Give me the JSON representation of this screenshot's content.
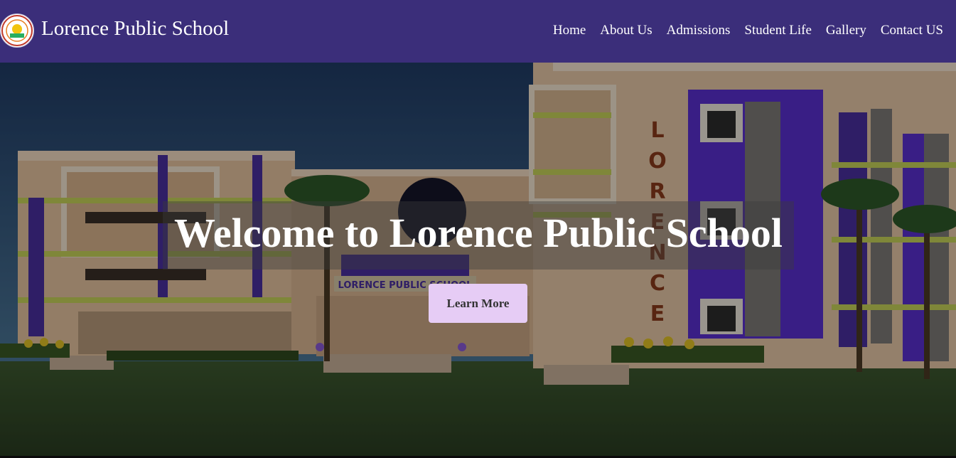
{
  "brand": {
    "name": "Lorence Public School",
    "logo_icon": "school-crest-icon"
  },
  "nav": {
    "items": [
      "Home",
      "About Us",
      "Admissions",
      "Student Life",
      "Gallery",
      "Contact US"
    ]
  },
  "hero": {
    "headline": "Welcome to Lorence Public School",
    "cta_label": "Learn More",
    "building_sign": "LORENCE PUBLIC SCHOOL",
    "tower_letters": "LORENCE"
  },
  "colors": {
    "navbar": "#3b2e7a",
    "cta_bg": "#e6ccf5",
    "accent_purple": "#5a2fd0",
    "wall": "#e8c9a8"
  }
}
